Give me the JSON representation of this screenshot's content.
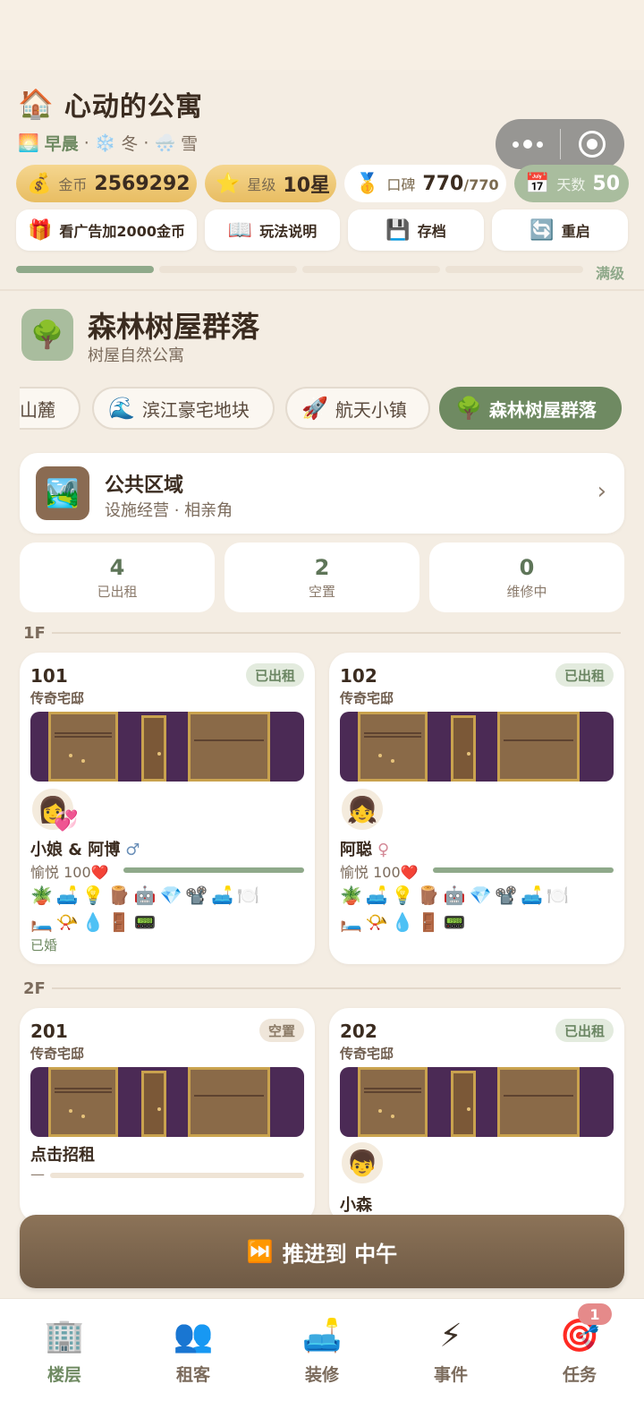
{
  "header": {
    "icon": "house-icon",
    "title": "心动的公寓",
    "time_period": "早晨",
    "season": "冬",
    "weather": "雪",
    "separator": "·"
  },
  "stats": {
    "gold_label": "金币",
    "gold_value": "2569292",
    "star_label": "星级",
    "star_value": "10星",
    "reputation_label": "口碑",
    "reputation_value": "770",
    "reputation_max": "/770",
    "days_label": "天数",
    "days_value": "50"
  },
  "actions": {
    "ad_label": "看广告加2000金币",
    "guide_label": "玩法说明",
    "save_label": "存档",
    "restart_label": "重启"
  },
  "level_progress": {
    "max_label": "满级",
    "segments_filled": 1,
    "segments_total": 4
  },
  "building": {
    "name": "森林树屋群落",
    "subtitle": "树屋自然公寓"
  },
  "building_tabs": [
    {
      "label": "山麓",
      "icon": "mountain-icon",
      "active": false
    },
    {
      "label": "滨江豪宅地块",
      "icon": "wave-icon",
      "active": false
    },
    {
      "label": "航天小镇",
      "icon": "rocket-icon",
      "active": false
    },
    {
      "label": "森林树屋群落",
      "icon": "tree-icon",
      "active": true
    }
  ],
  "public_area": {
    "title": "公共区域",
    "subtitle": "设施经营 · 相亲角"
  },
  "counts": [
    {
      "value": "4",
      "label": "已出租"
    },
    {
      "value": "2",
      "label": "空置"
    },
    {
      "value": "0",
      "label": "维修中"
    }
  ],
  "floors": {
    "f1": "1F",
    "f2": "2F"
  },
  "rooms": {
    "r101": {
      "number": "101",
      "type": "传奇宅邸",
      "status": "已出租",
      "tenant": "小娘 & 阿博",
      "gender": "♂",
      "mood": "愉悦 100",
      "mood_level": 1.0,
      "items_row1": "🪴🛋️💡🪵🤖💎📽️🛋️🍽️",
      "items_row2": "🛏️📯💧🚪📟",
      "note": "已婚"
    },
    "r102": {
      "number": "102",
      "type": "传奇宅邸",
      "status": "已出租",
      "tenant": "阿聪",
      "gender": "♀",
      "mood": "愉悦 100",
      "mood_level": 1.0,
      "items_row1": "🪴🛋️💡🪵🤖💎📽️🛋️🍽️",
      "items_row2": "🛏️📯💧🚪📟"
    },
    "r201": {
      "number": "201",
      "type": "传奇宅邸",
      "status": "空置",
      "action": "点击招租",
      "dash": "—"
    },
    "r202": {
      "number": "202",
      "type": "传奇宅邸",
      "status": "已出租",
      "tenant": "小森"
    }
  },
  "advance_button": {
    "label": "推进到 中午",
    "icon": "fast-forward-icon"
  },
  "tab_bar": [
    {
      "label": "楼层",
      "icon": "building-icon",
      "active": true
    },
    {
      "label": "租客",
      "icon": "people-icon",
      "active": false
    },
    {
      "label": "装修",
      "icon": "sofa-icon",
      "active": false
    },
    {
      "label": "事件",
      "icon": "lightning-icon",
      "active": false
    },
    {
      "label": "任务",
      "icon": "target-icon",
      "active": false,
      "badge": "1"
    }
  ],
  "colors": {
    "background": "#f4ede3",
    "accent_green": "#6f8a62",
    "gold_pill": "#f2cf7d",
    "advance_button": "#7a644e"
  }
}
